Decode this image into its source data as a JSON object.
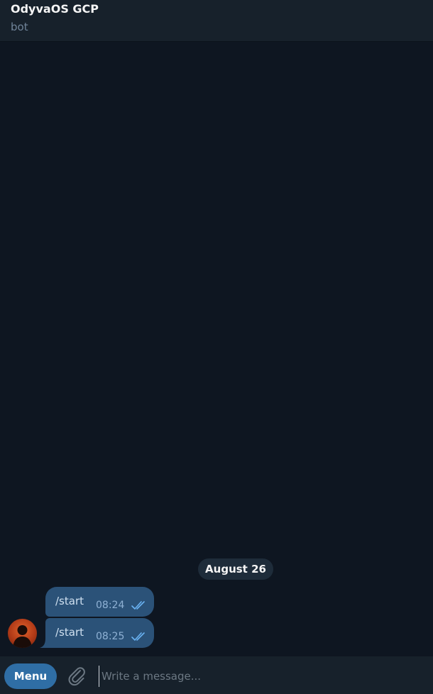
{
  "header": {
    "title": "OdyvaOS GCP",
    "subtitle": "bot"
  },
  "date_separator": "August 26",
  "messages": [
    {
      "text": "/start",
      "time": "08:24",
      "status_icon": "double-check-icon"
    },
    {
      "text": "/start",
      "time": "08:25",
      "status_icon": "double-check-icon"
    }
  ],
  "composer": {
    "menu_label": "Menu",
    "attach_icon": "paperclip-icon",
    "placeholder": "Write a message..."
  },
  "colors": {
    "background": "#0e1621",
    "header": "#17212b",
    "bubble_outgoing": "#2b5278",
    "menu_button": "#2f6ea5",
    "check_marks": "#6ab2f2"
  }
}
